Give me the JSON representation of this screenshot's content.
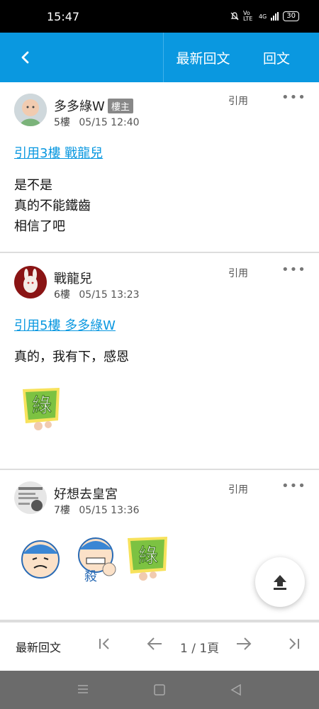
{
  "status_bar": {
    "time": "15:47",
    "volte": "Vo LTE",
    "network": "4G",
    "battery": "30"
  },
  "topbar": {
    "back_icon": "chevron-left-icon",
    "latest_label": "最新回文",
    "reply_label": "回文"
  },
  "posts": [
    {
      "author": "多多綠W",
      "badge": "樓主",
      "floor": "5樓",
      "datetime": "05/15 12:40",
      "quote_label": "引用",
      "more": "•••",
      "quote_link": "引用3樓 戰龍兒",
      "lines": [
        "是不是",
        "真的不能鐵齒",
        "相信了吧"
      ]
    },
    {
      "author": "戰龍兒",
      "floor": "6樓",
      "datetime": "05/15 13:23",
      "quote_label": "引用",
      "more": "•••",
      "quote_link": "引用5樓 多多綠W",
      "lines": [
        "真的，我有下，感恩"
      ],
      "stickers": [
        {
          "text": "綠"
        }
      ]
    },
    {
      "author": "好想去皇宮",
      "floor": "7樓",
      "datetime": "05/15 13:36",
      "quote_label": "引用",
      "more": "•••",
      "stickers": [
        {
          "text": ""
        },
        {
          "text": "殺"
        },
        {
          "text": "綠"
        }
      ]
    }
  ],
  "fab": {
    "icon": "upload-icon"
  },
  "bottombar": {
    "latest_label": "最新回文",
    "page_indicator": "1 / 1頁"
  },
  "colors": {
    "accent": "#0a98e0",
    "sticker_green": "#7cc242"
  }
}
